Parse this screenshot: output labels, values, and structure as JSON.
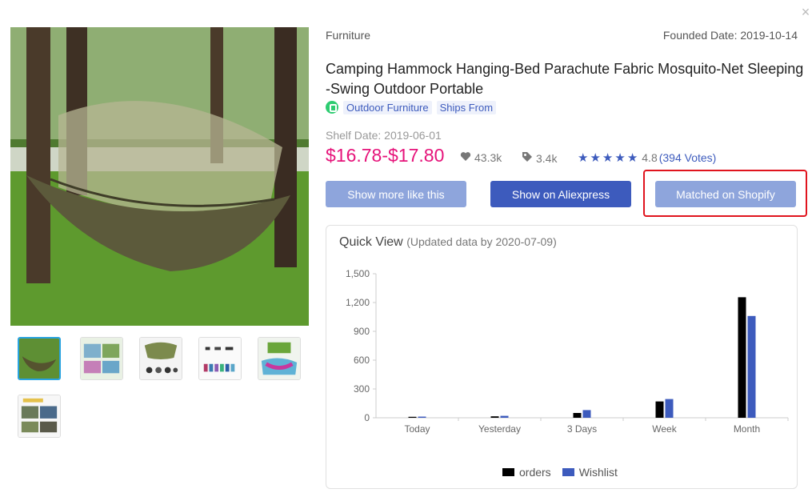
{
  "window": {
    "close_symbol": "×"
  },
  "product": {
    "category": "Furniture",
    "founded_date": "Founded Date: 2019-10-14",
    "title": "Camping Hammock Hanging-Bed Parachute Fabric Mosquito-Net Sleeping-Swing Outdoor Portable",
    "tags": [
      "Outdoor Furniture",
      "Ships From"
    ],
    "shelf_date": "Shelf Date: 2019-06-01",
    "price": "$16.78-$17.80",
    "likes": "43.3k",
    "orders": "3.4k",
    "rating": "4.8",
    "votes": "(394 Votes)",
    "stars_count": 5
  },
  "buttons": {
    "more_like": "Show more like this",
    "aliexpress": "Show on Aliexpress",
    "shopify": "Matched on Shopify"
  },
  "gallery": {
    "icon": "hammock-photo",
    "thumb_count": 6
  },
  "quick_view": {
    "title": "Quick View",
    "subtitle": "(Updated data by 2020-07-09)"
  },
  "colors": {
    "accent": "#3d5bbd",
    "accent_light": "#8ea5dc",
    "price": "#e6137a",
    "highlight": "#e0141e",
    "orders_series": "#000000",
    "wishlist_series": "#3d5bbd"
  },
  "chart_data": {
    "type": "bar",
    "categories": [
      "Today",
      "Yesterday",
      "3 Days",
      "Week",
      "Month"
    ],
    "series": [
      {
        "name": "orders",
        "values": [
          10,
          15,
          50,
          170,
          1255
        ]
      },
      {
        "name": "Wishlist",
        "values": [
          12,
          20,
          80,
          195,
          1060
        ]
      }
    ],
    "ylim": [
      0,
      1500
    ],
    "yticks": [
      0,
      300,
      600,
      900,
      "1,200",
      "1,500"
    ],
    "ytick_values": [
      0,
      300,
      600,
      900,
      1200,
      1500
    ],
    "grid": false,
    "legend": "bottom"
  }
}
